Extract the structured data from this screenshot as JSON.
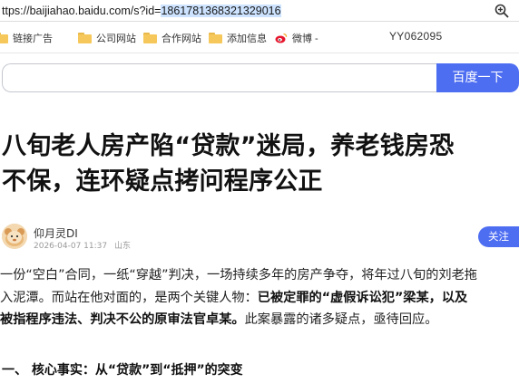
{
  "browser": {
    "url_prefix": "ttps://baijiahao.baidu.com/s?id=",
    "url_selected": "1861781368321329016"
  },
  "bookmarks": {
    "items": [
      {
        "label": "链接广告"
      },
      {
        "label": "公司网站"
      },
      {
        "label": "合作网站"
      },
      {
        "label": "添加信息"
      },
      {
        "label": "微博 -"
      }
    ],
    "id_text": "YY062095"
  },
  "search": {
    "button_label": "百度一下",
    "value": ""
  },
  "article": {
    "title_line1": "八旬老人房产陷“贷款”迷局，养老钱房恐",
    "title_line2": "不保，连环疑点拷问程序公正",
    "author": {
      "name": "仰月灵DI",
      "date": "2026-04-07 11:37",
      "location": "山东",
      "follow_label": "关注"
    },
    "paragraph": {
      "l1": "一份“空白”合同，一纸“穿越”判决，一场持续多年的房产争夺，将年过八旬的刘老拖",
      "l2_plain": "入泥潭。而站在他对面的，是两个关键人物：",
      "l2_bold": "已被定罪的“虚假诉讼犯”梁某，以及",
      "l3_bold": "被指程序违法、判决不公的原审法官卓某。",
      "l3_plain": "此案暴露的诸多疑点，亟待回应。"
    },
    "section_heading": "一、 核心事实：从“贷款”到“抵押”的突变"
  },
  "colors": {
    "accent": "#4e6ef2",
    "folder": "#f6c85b"
  }
}
